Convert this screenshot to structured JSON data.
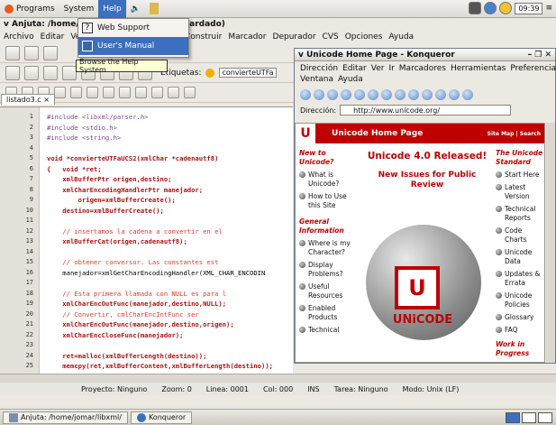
{
  "top_panel": {
    "menus": [
      "Programs",
      "System",
      "Help"
    ],
    "clock": "09:39"
  },
  "help_menu": {
    "items": [
      {
        "label": "Web Support"
      },
      {
        "label": "User's Manual"
      }
    ],
    "tooltip": "Browse the Help System"
  },
  "anjuta": {
    "title": "v  Anjuta: /home/joma",
    "title_suffix": "Guardado)",
    "menu": [
      "Archivo",
      "Editar",
      "Ver"
    ],
    "menu_right": [
      "Construir",
      "Marcador",
      "Depurador",
      "CVS",
      "Opciones",
      "Ayuda"
    ],
    "etiquetas_label": "Etiquetas:",
    "etiquetas_value": "convierteUTFa",
    "tab": "listado3.c ×",
    "lines": [
      "1",
      "2",
      "3",
      "4",
      "5",
      "6",
      "7",
      "8",
      "9",
      "10",
      "11",
      "12",
      "13",
      "14",
      "15",
      "16",
      "17",
      "18",
      "19",
      "20",
      "21",
      "22",
      "23",
      "24",
      "25"
    ],
    "code": [
      "#include <libxml/parser.h>",
      "#include <stdio.h>",
      "#include <string.h>",
      "",
      "void *convierteUTFaUCS2(xmlChar *cadenautf8)",
      "{   void *ret;",
      "    xmlBufferPtr origen,destino;",
      "    xmlCharEncodingHandlerPtr manejador;",
      "        origen=xmlBufferCreate();",
      "    destino=xmlBufferCreate();",
      "",
      "    // insertamos la cadena a convertir en el",
      "    xmlBufferCat(origen,cadenautf8);",
      "",
      "    // obtener conversor. Las constantes est",
      "    manejador=xmlGetCharEncodingHandler(XML_CHAR_ENCODIN",
      "",
      "    // Esta primera llamada con NULL es para l",
      "    xmlCharEncOutFunc(manejador,destino,NULL);",
      "    // Convertir, cmlCharEncIntFunc ser",
      "    xmlCharEncOutFunc(manejador,destino,origen);",
      "    xmlCharEncCloseFunc(manejador);",
      "",
      "    ret=malloc(xmlBufferLength(destino));",
      "    memcpy(ret,xmlBufferContent,xmlBufferLength(destino));"
    ],
    "status": [
      "Proyecto: Ninguno",
      "Zoom: 0",
      "Linea: 0001",
      "Col: 000",
      "INS",
      "Tarea: Ninguno",
      "Modo: Unix (LF)"
    ]
  },
  "konqueror": {
    "title": "v  Unicode Home Page - Konqueror",
    "menu1": [
      "Dirección",
      "Editar",
      "Ver",
      "Ir",
      "Marcadores",
      "Herramientas",
      "Preferencias"
    ],
    "menu2": [
      "Ventana",
      "Ayuda"
    ],
    "location_label": "Dirección:",
    "url": "http://www.unicode.org/",
    "page": {
      "header": "Unicode Home Page",
      "header_links": "Site Map | Search",
      "logo": "U",
      "new_to": "New to Unicode?",
      "new_items": [
        "What is Unicode?",
        "How to Use this Site"
      ],
      "general": "General Information",
      "general_items": [
        "Where is my Character?",
        "Display Problems?",
        "Useful Resources",
        "Enabled Products",
        "Technical"
      ],
      "headline": "Unicode 4.0 Released!",
      "subhead": "New Issues for Public Review",
      "wordmark": "UNiCODE",
      "right_head": "The Unicode Standard",
      "right_items": [
        "Start Here",
        "Latest Version",
        "Technical Reports",
        "Code Charts",
        "Unicode Data",
        "Updates & Errata",
        "Unicode Policies",
        "Glossary",
        "FAQ"
      ],
      "work": "Work in Progress"
    }
  },
  "taskbar": [
    "Anjuta: /home/jomar/libxml/",
    "Konqueror"
  ]
}
